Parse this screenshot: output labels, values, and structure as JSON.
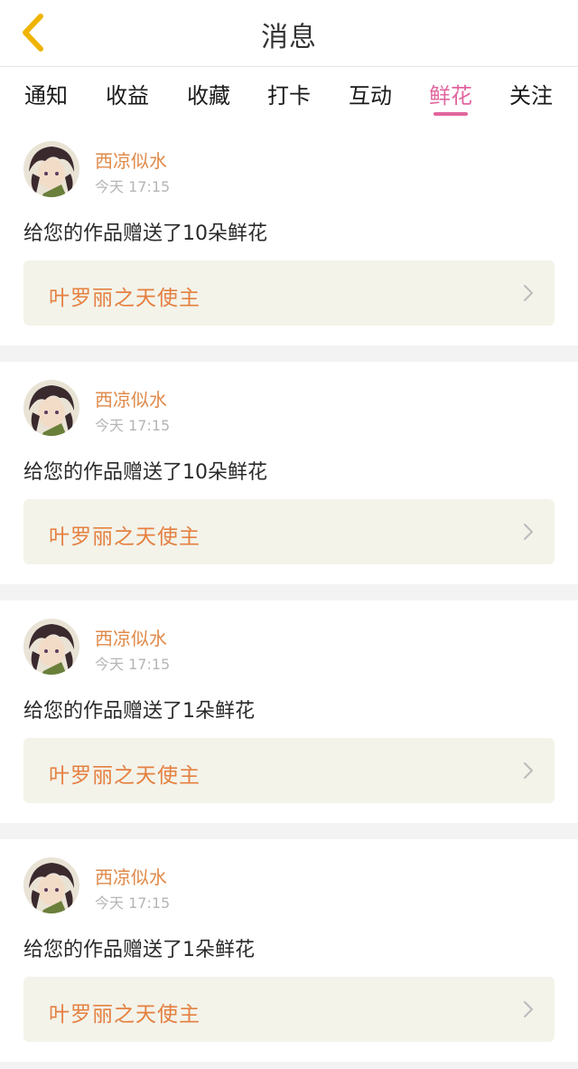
{
  "header": {
    "title": "消息"
  },
  "tabs": [
    {
      "label": "通知",
      "active": false
    },
    {
      "label": "收益",
      "active": false
    },
    {
      "label": "收藏",
      "active": false
    },
    {
      "label": "打卡",
      "active": false
    },
    {
      "label": "互动",
      "active": false
    },
    {
      "label": "鲜花",
      "active": true
    },
    {
      "label": "关注",
      "active": false
    }
  ],
  "colors": {
    "accent_tab": "#e0669e",
    "sender_name": "#e08a4a",
    "work_title": "#e58040",
    "link_bg": "#f3f3ea"
  },
  "messages": [
    {
      "sender": "西凉似水",
      "time": "今天 17:15",
      "text": "给您的作品赠送了10朵鲜花",
      "work": "叶罗丽之天使主"
    },
    {
      "sender": "西凉似水",
      "time": "今天 17:15",
      "text": "给您的作品赠送了10朵鲜花",
      "work": "叶罗丽之天使主"
    },
    {
      "sender": "西凉似水",
      "time": "今天 17:15",
      "text": "给您的作品赠送了1朵鲜花",
      "work": "叶罗丽之天使主"
    },
    {
      "sender": "西凉似水",
      "time": "今天 17:15",
      "text": "给您的作品赠送了1朵鲜花",
      "work": "叶罗丽之天使主"
    }
  ]
}
